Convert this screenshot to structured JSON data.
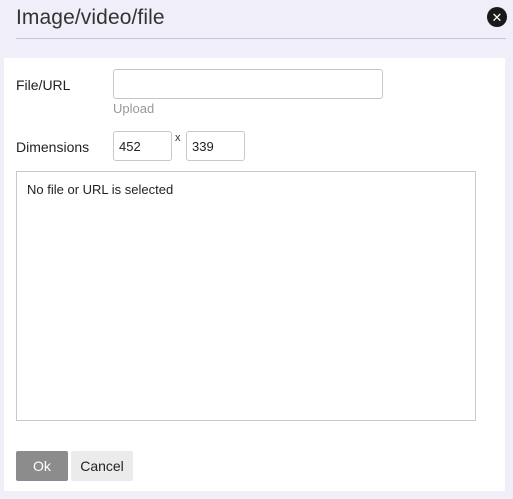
{
  "dialog": {
    "title": "Image/video/file",
    "close_icon": "close-circle-icon"
  },
  "form": {
    "file_url_label": "File/URL",
    "file_url_value": "",
    "upload_link": "Upload",
    "dimensions_label": "Dimensions",
    "width_value": "452",
    "height_value": "339",
    "dimension_separator": "x"
  },
  "preview": {
    "message": "No file or URL is selected"
  },
  "buttons": {
    "ok_label": "Ok",
    "cancel_label": "Cancel"
  },
  "colors": {
    "background": "#f0eef8",
    "panel": "#ffffff",
    "ok_button": "#8c8c8c",
    "cancel_button": "#ebebeb"
  }
}
